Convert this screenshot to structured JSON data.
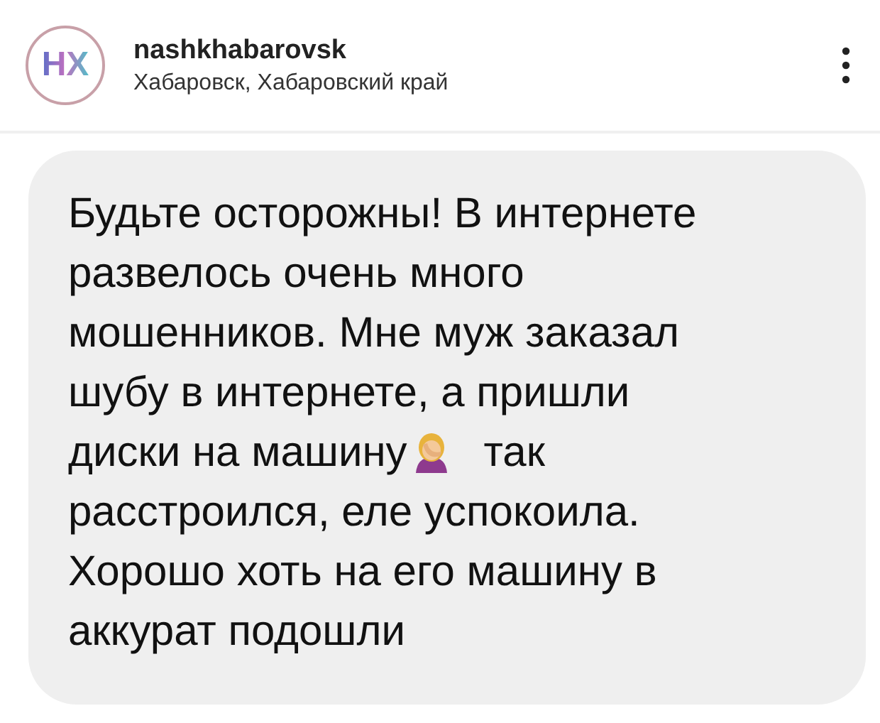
{
  "post_header": {
    "logo_text": "HX",
    "username": "nashkhabarovsk",
    "location": "Хабаровск, Хабаровский край"
  },
  "message": {
    "lines": [
      {
        "kind": "text",
        "text": "Будьте осторожны! В интернете"
      },
      {
        "kind": "text",
        "text": "развелось очень много"
      },
      {
        "kind": "text",
        "text": "мошенников. Мне муж заказал"
      },
      {
        "kind": "text",
        "text": "шубу в интернете, а пришли"
      },
      {
        "kind": "emoji",
        "text": "диски на машину",
        "text_after": "так"
      },
      {
        "kind": "text",
        "text": "расстроился, еле успокоила."
      },
      {
        "kind": "text",
        "text": "Хорошо хоть на его машину в"
      },
      {
        "kind": "text",
        "text": "аккурат подошли"
      }
    ]
  }
}
